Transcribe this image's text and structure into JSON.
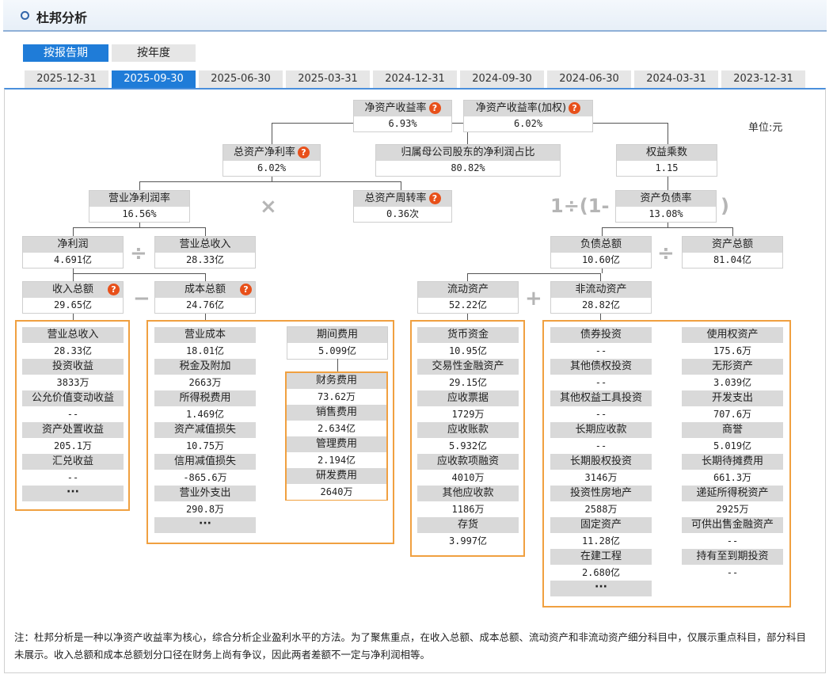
{
  "header": {
    "title": "杜邦分析"
  },
  "period_tabs": [
    "按报告期",
    "按年度"
  ],
  "date_tabs": [
    "2025-12-31",
    "2025-09-30",
    "2025-06-30",
    "2025-03-31",
    "2024-12-31",
    "2024-09-30",
    "2024-06-30",
    "2024-03-31",
    "2023-12-31"
  ],
  "unit": "单位:元",
  "q_mark": "?",
  "more": "···",
  "ops": {
    "times": "×",
    "div": "÷",
    "minus": "−",
    "plus": "+",
    "one_div": "1÷(1-",
    "paren": ")"
  },
  "nodes": {
    "roe": {
      "label": "净资产收益率",
      "value": "6.93%"
    },
    "roe_w": {
      "label": "净资产收益率(加权)",
      "value": "6.02%"
    },
    "roa": {
      "label": "总资产净利率",
      "value": "6.02%"
    },
    "parent_ratio": {
      "label": "归属母公司股东的净利润占比",
      "value": "80.82%"
    },
    "equity_mult": {
      "label": "权益乘数",
      "value": "1.15"
    },
    "net_margin": {
      "label": "营业净利润率",
      "value": "16.56%"
    },
    "asset_turn": {
      "label": "总资产周转率",
      "value": "0.36次"
    },
    "debt_ratio": {
      "label": "资产负债率",
      "value": "13.08%"
    },
    "net_profit": {
      "label": "净利润",
      "value": "4.691亿"
    },
    "total_rev": {
      "label": "营业总收入",
      "value": "28.33亿"
    },
    "total_liab": {
      "label": "负债总额",
      "value": "10.60亿"
    },
    "total_assets": {
      "label": "资产总额",
      "value": "81.04亿"
    },
    "income_total": {
      "label": "收入总额",
      "value": "29.65亿"
    },
    "cost_total": {
      "label": "成本总额",
      "value": "24.76亿"
    },
    "cur_assets": {
      "label": "流动资产",
      "value": "52.22亿"
    },
    "noncur_assets": {
      "label": "非流动资产",
      "value": "28.82亿"
    }
  },
  "income_items": [
    {
      "label": "营业总收入",
      "value": "28.33亿"
    },
    {
      "label": "投资收益",
      "value": "3833万"
    },
    {
      "label": "公允价值变动收益",
      "value": "--"
    },
    {
      "label": "资产处置收益",
      "value": "205.1万"
    },
    {
      "label": "汇兑收益",
      "value": "--"
    }
  ],
  "cost_items": [
    {
      "label": "营业成本",
      "value": "18.01亿"
    },
    {
      "label": "税金及附加",
      "value": "2663万"
    },
    {
      "label": "所得税费用",
      "value": "1.469亿"
    },
    {
      "label": "资产减值损失",
      "value": "10.75万"
    },
    {
      "label": "信用减值损失",
      "value": "-865.6万"
    },
    {
      "label": "营业外支出",
      "value": "290.8万"
    }
  ],
  "period_expense": {
    "label": "期间费用",
    "value": "5.099亿"
  },
  "expense_items": [
    {
      "label": "财务费用",
      "value": "73.62万"
    },
    {
      "label": "销售费用",
      "value": "2.634亿"
    },
    {
      "label": "管理费用",
      "value": "2.194亿"
    },
    {
      "label": "研发费用",
      "value": "2640万"
    }
  ],
  "cur_items": [
    {
      "label": "货币资金",
      "value": "10.95亿"
    },
    {
      "label": "交易性金融资产",
      "value": "29.15亿"
    },
    {
      "label": "应收票据",
      "value": "1729万"
    },
    {
      "label": "应收账款",
      "value": "5.932亿"
    },
    {
      "label": "应收款项融资",
      "value": "4010万"
    },
    {
      "label": "其他应收款",
      "value": "1186万"
    },
    {
      "label": "存货",
      "value": "3.997亿"
    }
  ],
  "noncur_items_a": [
    {
      "label": "债券投资",
      "value": "--"
    },
    {
      "label": "其他债权投资",
      "value": "--"
    },
    {
      "label": "其他权益工具投资",
      "value": "--"
    },
    {
      "label": "长期应收款",
      "value": "--"
    },
    {
      "label": "长期股权投资",
      "value": "3146万"
    },
    {
      "label": "投资性房地产",
      "value": "2588万"
    },
    {
      "label": "固定资产",
      "value": "11.28亿"
    },
    {
      "label": "在建工程",
      "value": "2.680亿"
    }
  ],
  "noncur_items_b": [
    {
      "label": "使用权资产",
      "value": "175.6万"
    },
    {
      "label": "无形资产",
      "value": "3.039亿"
    },
    {
      "label": "开发支出",
      "value": "707.6万"
    },
    {
      "label": "商誉",
      "value": "5.019亿"
    },
    {
      "label": "长期待摊费用",
      "value": "661.3万"
    },
    {
      "label": "递延所得税资产",
      "value": "2925万"
    },
    {
      "label": "可供出售金融资产",
      "value": "--"
    },
    {
      "label": "持有至到期投资",
      "value": "--"
    }
  ],
  "note": "注：杜邦分析是一种以净资产收益率为核心，综合分析企业盈利水平的方法。为了聚焦重点，在收入总额、成本总额、流动资产和非流动资产细分科目中，仅展示重点科目，部分科目未展示。收入总额和成本总额划分口径在财务上尚有争议，因此两者差额不一定与净利润相等。"
}
